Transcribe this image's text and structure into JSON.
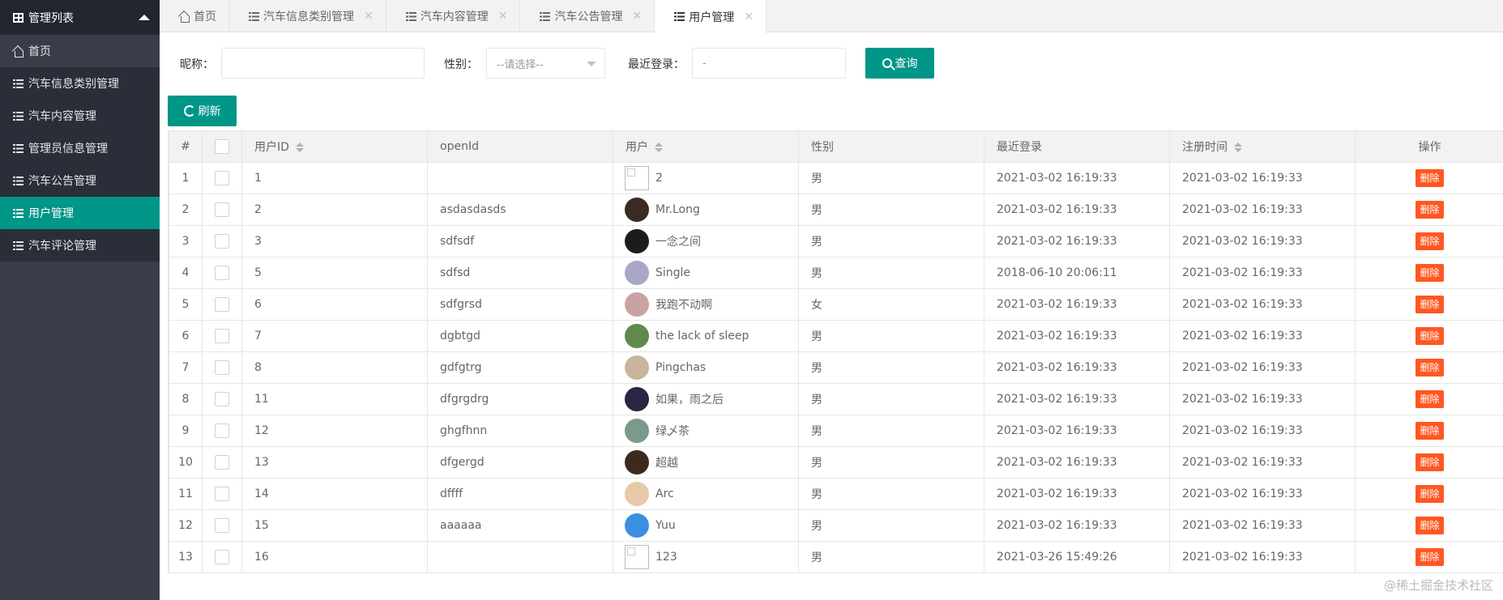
{
  "sidebar": {
    "header_title": "管理列表",
    "items": [
      {
        "label": "首页",
        "icon": "home-icon"
      },
      {
        "label": "汽车信息类别管理",
        "icon": "list-icon"
      },
      {
        "label": "汽车内容管理",
        "icon": "list-icon"
      },
      {
        "label": "管理员信息管理",
        "icon": "list-icon"
      },
      {
        "label": "汽车公告管理",
        "icon": "list-icon"
      },
      {
        "label": "用户管理",
        "icon": "list-icon",
        "active": true
      },
      {
        "label": "汽车评论管理",
        "icon": "list-icon"
      }
    ]
  },
  "tabs": [
    {
      "label": "首页",
      "icon": "home-icon"
    },
    {
      "label": "汽车信息类别管理",
      "icon": "list-icon",
      "closable": true
    },
    {
      "label": "汽车内容管理",
      "icon": "list-icon",
      "closable": true
    },
    {
      "label": "汽车公告管理",
      "icon": "list-icon",
      "closable": true
    },
    {
      "label": "用户管理",
      "icon": "list-icon",
      "closable": true,
      "active": true
    }
  ],
  "search": {
    "nickname_label": "昵称：",
    "nickname_value": "",
    "gender_label": "性别：",
    "gender_selected": "--请选择--",
    "last_login_label": "最近登录：",
    "last_login_value": "-",
    "query_button": "查询",
    "refresh_button": "刷新"
  },
  "table": {
    "headers": {
      "index": "#",
      "user_id": "用户ID",
      "openid": "openId",
      "user": "用户",
      "gender": "性别",
      "last_login": "最近登录",
      "register_time": "注册时间",
      "operation": "操作"
    },
    "delete_label": "删除",
    "rows": [
      {
        "idx": "1",
        "id": "1",
        "openid": "",
        "name": "2",
        "avatar": "broken",
        "gender": "男",
        "last_login": "2021-03-02 16:19:33",
        "reg": "2021-03-02 16:19:33"
      },
      {
        "idx": "2",
        "id": "2",
        "openid": "asdasdasds",
        "name": "Mr.Long",
        "avatar": "#3a2c22",
        "gender": "男",
        "last_login": "2021-03-02 16:19:33",
        "reg": "2021-03-02 16:19:33"
      },
      {
        "idx": "3",
        "id": "3",
        "openid": "sdfsdf",
        "name": "一念之间",
        "avatar": "#1c1c1c",
        "gender": "男",
        "last_login": "2021-03-02 16:19:33",
        "reg": "2021-03-02 16:19:33"
      },
      {
        "idx": "4",
        "id": "5",
        "openid": "sdfsd",
        "name": "Single",
        "avatar": "#a9a7c8",
        "gender": "男",
        "last_login": "2018-06-10 20:06:11",
        "reg": "2021-03-02 16:19:33"
      },
      {
        "idx": "5",
        "id": "6",
        "openid": "sdfgrsd",
        "name": "我跑不动啊",
        "avatar": "#c9a3a3",
        "gender": "女",
        "last_login": "2021-03-02 16:19:33",
        "reg": "2021-03-02 16:19:33"
      },
      {
        "idx": "6",
        "id": "7",
        "openid": "dgbtgd",
        "name": "the lack of sleep",
        "avatar": "#5e8a4e",
        "gender": "男",
        "last_login": "2021-03-02 16:19:33",
        "reg": "2021-03-02 16:19:33"
      },
      {
        "idx": "7",
        "id": "8",
        "openid": "gdfgtrg",
        "name": "Pingchas",
        "avatar": "#c8b59a",
        "gender": "男",
        "last_login": "2021-03-02 16:19:33",
        "reg": "2021-03-02 16:19:33"
      },
      {
        "idx": "8",
        "id": "11",
        "openid": "dfgrgdrg",
        "name": "如果，雨之后",
        "avatar": "#2a2540",
        "gender": "男",
        "last_login": "2021-03-02 16:19:33",
        "reg": "2021-03-02 16:19:33"
      },
      {
        "idx": "9",
        "id": "12",
        "openid": "ghgfhnn",
        "name": "绿乄茶",
        "avatar": "#7a9a8a",
        "gender": "男",
        "last_login": "2021-03-02 16:19:33",
        "reg": "2021-03-02 16:19:33"
      },
      {
        "idx": "10",
        "id": "13",
        "openid": "dfgergd",
        "name": "超越",
        "avatar": "#3d2a1e",
        "gender": "男",
        "last_login": "2021-03-02 16:19:33",
        "reg": "2021-03-02 16:19:33"
      },
      {
        "idx": "11",
        "id": "14",
        "openid": "dffff",
        "name": "Arc",
        "avatar": "#e8c9a8",
        "gender": "男",
        "last_login": "2021-03-02 16:19:33",
        "reg": "2021-03-02 16:19:33"
      },
      {
        "idx": "12",
        "id": "15",
        "openid": "aaaaaa",
        "name": "Yuu",
        "avatar": "#3a8fe0",
        "gender": "男",
        "last_login": "2021-03-02 16:19:33",
        "reg": "2021-03-02 16:19:33"
      },
      {
        "idx": "13",
        "id": "16",
        "openid": "",
        "name": "123",
        "avatar": "broken",
        "gender": "男",
        "last_login": "2021-03-26 15:49:26",
        "reg": "2021-03-02 16:19:33"
      }
    ]
  },
  "watermark": "@稀土掘金技术社区",
  "colors": {
    "primary": "#009688",
    "danger": "#ff5722",
    "sidebar": "#393d49"
  }
}
